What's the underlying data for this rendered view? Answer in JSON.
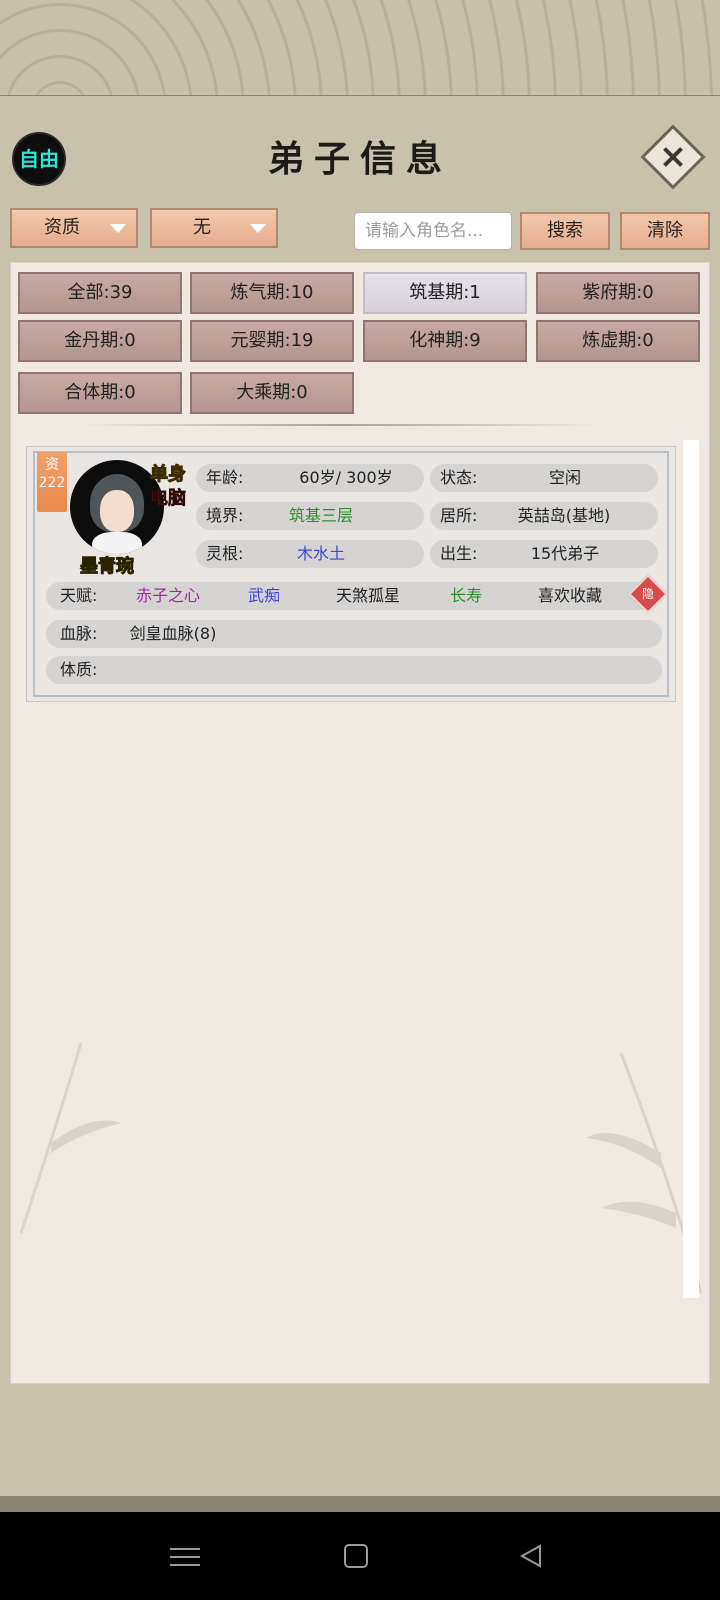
{
  "header": {
    "mode_badge": "自由",
    "title": "弟子信息"
  },
  "filters": {
    "sort_dropdown": "资质",
    "secondary_dropdown": "无",
    "search_placeholder": "请输入角色名...",
    "search_button": "搜索",
    "clear_button": "清除"
  },
  "tabs": [
    {
      "label": "全部:39",
      "active": false
    },
    {
      "label": "炼气期:10",
      "active": false
    },
    {
      "label": "筑基期:1",
      "active": true
    },
    {
      "label": "紫府期:0",
      "active": false
    },
    {
      "label": "金丹期:0",
      "active": false
    },
    {
      "label": "元婴期:19",
      "active": false
    },
    {
      "label": "化神期:9",
      "active": false
    },
    {
      "label": "炼虚期:0",
      "active": false
    },
    {
      "label": "合体期:0",
      "active": false
    },
    {
      "label": "大乘期:0",
      "active": false
    }
  ],
  "disciple": {
    "aptitude_label": "资",
    "aptitude_value": "222",
    "relationship_tag": "单身",
    "control_tag": "电脑",
    "name": "墨青琬",
    "age_label": "年龄:",
    "age_value": "60岁/ 300岁",
    "status_label": "状态:",
    "status_value": "空闲",
    "realm_label": "境界:",
    "realm_value": "筑基三层",
    "residence_label": "居所:",
    "residence_value": "英喆岛(基地)",
    "root_label": "灵根:",
    "root_value": "木水土",
    "origin_label": "出生:",
    "origin_value": "15代弟子",
    "talent_label": "天赋:",
    "talents": [
      "赤子之心",
      "武痴",
      "天煞孤星",
      "长寿",
      "喜欢收藏"
    ],
    "hide_icon_label": "隐",
    "bloodline_label": "血脉:",
    "bloodline_value": "剑皇血脉(8)",
    "physique_label": "体质:",
    "physique_value": ""
  },
  "colors": {
    "panel_bg": "#efe9e1",
    "tab_bg": "#b89a94",
    "button_bg": "#eeb999",
    "realm_green": "#2f8f2f",
    "root_blue": "#3f46d6",
    "talent_purple": "#9f2a9f"
  }
}
